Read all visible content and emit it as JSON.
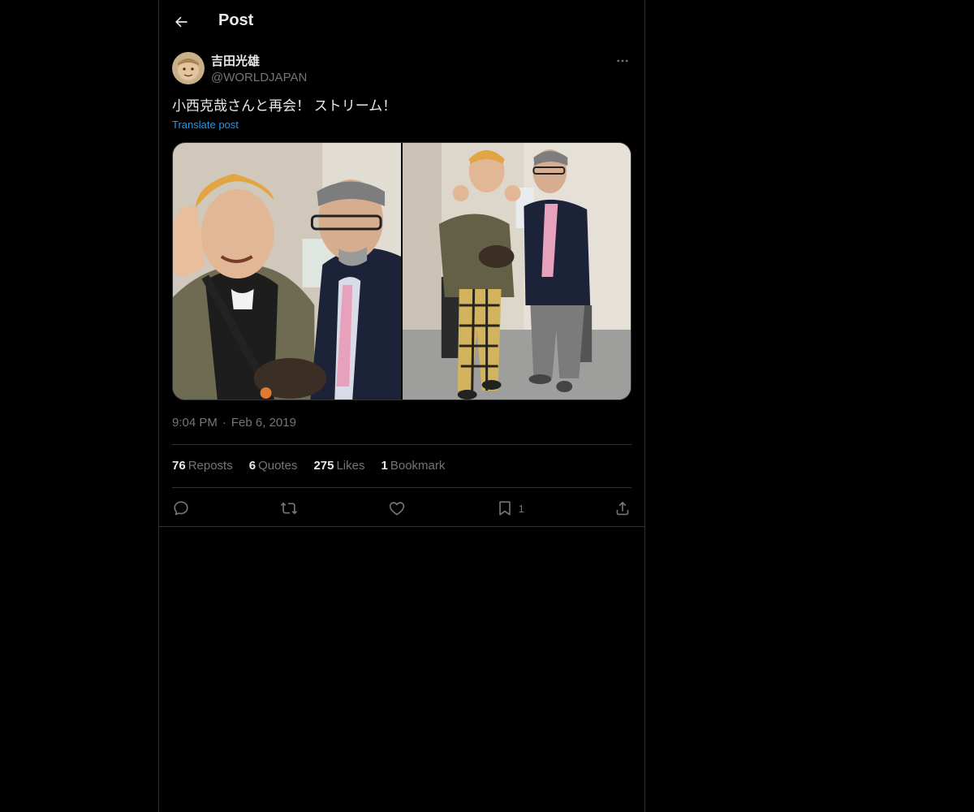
{
  "header": {
    "title": "Post",
    "back_icon": "arrow-left-icon"
  },
  "author": {
    "display_name": "吉田光雄",
    "handle": "@WORLDJAPAN",
    "more_icon": "more-horizontal-icon"
  },
  "post": {
    "text": "小西克哉さんと再会！ ストリーム！",
    "translate_label": "Translate post",
    "media_count": 2,
    "time": "9:04 PM",
    "separator": "·",
    "date": "Feb 6, 2019"
  },
  "stats": [
    {
      "count": "76",
      "label": "Reposts"
    },
    {
      "count": "6",
      "label": "Quotes"
    },
    {
      "count": "275",
      "label": "Likes"
    },
    {
      "count": "1",
      "label": "Bookmark"
    }
  ],
  "actions": {
    "reply_icon": "reply-icon",
    "repost_icon": "repost-icon",
    "like_icon": "like-icon",
    "bookmark_icon": "bookmark-icon",
    "bookmark_count": "1",
    "share_icon": "share-icon"
  },
  "colors": {
    "background": "#000000",
    "text": "#e7e9ea",
    "muted": "#71767b",
    "link": "#1d9bf0",
    "border": "#2f3336"
  }
}
